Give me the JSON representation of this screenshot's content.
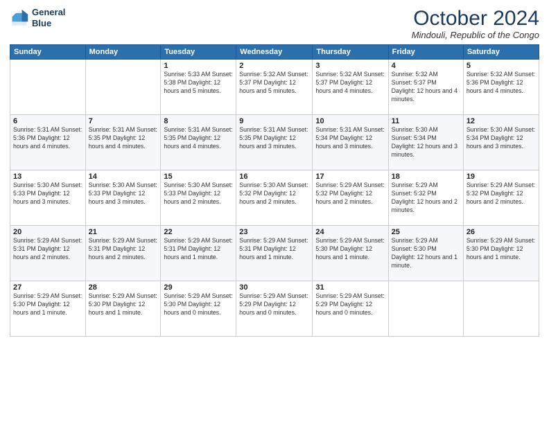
{
  "logo": {
    "line1": "General",
    "line2": "Blue"
  },
  "title": "October 2024",
  "location": "Mindouli, Republic of the Congo",
  "days_of_week": [
    "Sunday",
    "Monday",
    "Tuesday",
    "Wednesday",
    "Thursday",
    "Friday",
    "Saturday"
  ],
  "weeks": [
    [
      {
        "day": "",
        "info": ""
      },
      {
        "day": "",
        "info": ""
      },
      {
        "day": "1",
        "info": "Sunrise: 5:33 AM\nSunset: 5:38 PM\nDaylight: 12 hours\nand 5 minutes."
      },
      {
        "day": "2",
        "info": "Sunrise: 5:32 AM\nSunset: 5:37 PM\nDaylight: 12 hours\nand 5 minutes."
      },
      {
        "day": "3",
        "info": "Sunrise: 5:32 AM\nSunset: 5:37 PM\nDaylight: 12 hours\nand 4 minutes."
      },
      {
        "day": "4",
        "info": "Sunrise: 5:32 AM\nSunset: 5:37 PM\nDaylight: 12 hours\nand 4 minutes."
      },
      {
        "day": "5",
        "info": "Sunrise: 5:32 AM\nSunset: 5:36 PM\nDaylight: 12 hours\nand 4 minutes."
      }
    ],
    [
      {
        "day": "6",
        "info": "Sunrise: 5:31 AM\nSunset: 5:36 PM\nDaylight: 12 hours\nand 4 minutes."
      },
      {
        "day": "7",
        "info": "Sunrise: 5:31 AM\nSunset: 5:35 PM\nDaylight: 12 hours\nand 4 minutes."
      },
      {
        "day": "8",
        "info": "Sunrise: 5:31 AM\nSunset: 5:35 PM\nDaylight: 12 hours\nand 4 minutes."
      },
      {
        "day": "9",
        "info": "Sunrise: 5:31 AM\nSunset: 5:35 PM\nDaylight: 12 hours\nand 3 minutes."
      },
      {
        "day": "10",
        "info": "Sunrise: 5:31 AM\nSunset: 5:34 PM\nDaylight: 12 hours\nand 3 minutes."
      },
      {
        "day": "11",
        "info": "Sunrise: 5:30 AM\nSunset: 5:34 PM\nDaylight: 12 hours\nand 3 minutes."
      },
      {
        "day": "12",
        "info": "Sunrise: 5:30 AM\nSunset: 5:34 PM\nDaylight: 12 hours\nand 3 minutes."
      }
    ],
    [
      {
        "day": "13",
        "info": "Sunrise: 5:30 AM\nSunset: 5:33 PM\nDaylight: 12 hours\nand 3 minutes."
      },
      {
        "day": "14",
        "info": "Sunrise: 5:30 AM\nSunset: 5:33 PM\nDaylight: 12 hours\nand 3 minutes."
      },
      {
        "day": "15",
        "info": "Sunrise: 5:30 AM\nSunset: 5:33 PM\nDaylight: 12 hours\nand 2 minutes."
      },
      {
        "day": "16",
        "info": "Sunrise: 5:30 AM\nSunset: 5:32 PM\nDaylight: 12 hours\nand 2 minutes."
      },
      {
        "day": "17",
        "info": "Sunrise: 5:29 AM\nSunset: 5:32 PM\nDaylight: 12 hours\nand 2 minutes."
      },
      {
        "day": "18",
        "info": "Sunrise: 5:29 AM\nSunset: 5:32 PM\nDaylight: 12 hours\nand 2 minutes."
      },
      {
        "day": "19",
        "info": "Sunrise: 5:29 AM\nSunset: 5:32 PM\nDaylight: 12 hours\nand 2 minutes."
      }
    ],
    [
      {
        "day": "20",
        "info": "Sunrise: 5:29 AM\nSunset: 5:31 PM\nDaylight: 12 hours\nand 2 minutes."
      },
      {
        "day": "21",
        "info": "Sunrise: 5:29 AM\nSunset: 5:31 PM\nDaylight: 12 hours\nand 2 minutes."
      },
      {
        "day": "22",
        "info": "Sunrise: 5:29 AM\nSunset: 5:31 PM\nDaylight: 12 hours\nand 1 minute."
      },
      {
        "day": "23",
        "info": "Sunrise: 5:29 AM\nSunset: 5:31 PM\nDaylight: 12 hours\nand 1 minute."
      },
      {
        "day": "24",
        "info": "Sunrise: 5:29 AM\nSunset: 5:30 PM\nDaylight: 12 hours\nand 1 minute."
      },
      {
        "day": "25",
        "info": "Sunrise: 5:29 AM\nSunset: 5:30 PM\nDaylight: 12 hours\nand 1 minute."
      },
      {
        "day": "26",
        "info": "Sunrise: 5:29 AM\nSunset: 5:30 PM\nDaylight: 12 hours\nand 1 minute."
      }
    ],
    [
      {
        "day": "27",
        "info": "Sunrise: 5:29 AM\nSunset: 5:30 PM\nDaylight: 12 hours\nand 1 minute."
      },
      {
        "day": "28",
        "info": "Sunrise: 5:29 AM\nSunset: 5:30 PM\nDaylight: 12 hours\nand 1 minute."
      },
      {
        "day": "29",
        "info": "Sunrise: 5:29 AM\nSunset: 5:30 PM\nDaylight: 12 hours\nand 0 minutes."
      },
      {
        "day": "30",
        "info": "Sunrise: 5:29 AM\nSunset: 5:29 PM\nDaylight: 12 hours\nand 0 minutes."
      },
      {
        "day": "31",
        "info": "Sunrise: 5:29 AM\nSunset: 5:29 PM\nDaylight: 12 hours\nand 0 minutes."
      },
      {
        "day": "",
        "info": ""
      },
      {
        "day": "",
        "info": ""
      }
    ]
  ]
}
